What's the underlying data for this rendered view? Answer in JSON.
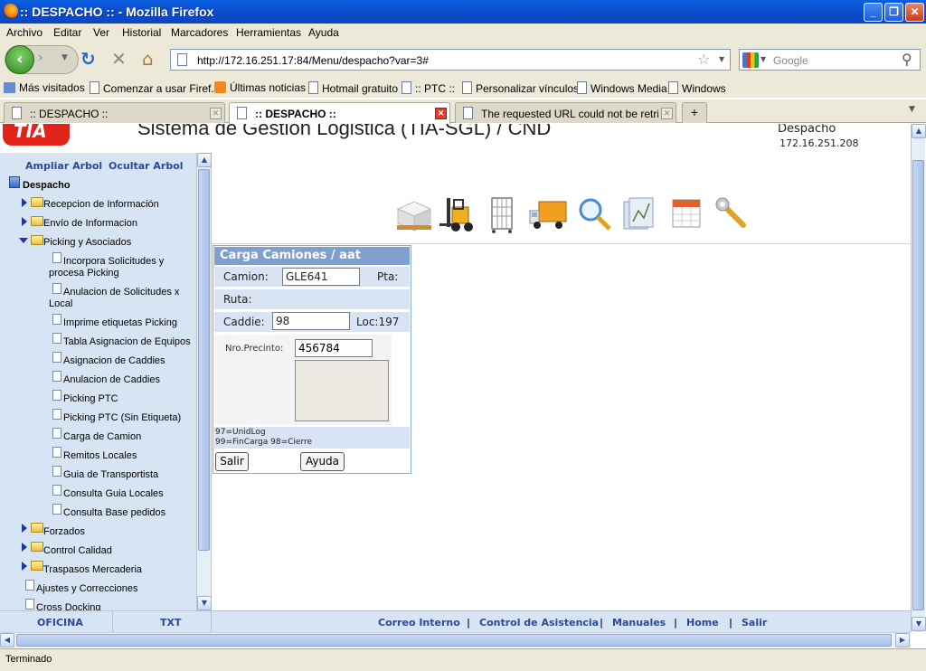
{
  "window": {
    "title": ":: DESPACHO :: - Mozilla Firefox"
  },
  "menu": [
    "Archivo",
    "Editar",
    "Ver",
    "Historial",
    "Marcadores",
    "Herramientas",
    "Ayuda"
  ],
  "nav": {
    "url": "http://172.16.251.17:84/Menu/despacho?var=3#",
    "search_placeholder": "Google"
  },
  "bookmarks": [
    "Más visitados",
    "Comenzar a usar Firef...",
    "Últimas noticias",
    "Hotmail gratuito",
    ":: PTC ::",
    "Personalizar vínculos",
    "Windows Media",
    "Windows"
  ],
  "tabs": [
    ":: DESPACHO ::",
    ":: DESPACHO ::",
    "The requested URL could not be retriev..."
  ],
  "header": {
    "logo_text": "TIA",
    "system_title": "Sistema de Gestion Logistica (TIA-SGL) / CND",
    "module": "Despacho",
    "host": "172.16.251.208"
  },
  "tree": {
    "expand_label": "Ampliar Arbol",
    "hide_label": "Ocultar Arbol",
    "root": "Despacho",
    "items": [
      {
        "label": "Recepcion de Información"
      },
      {
        "label": "Envío de Informacion"
      },
      {
        "label": "Picking y Asociados"
      },
      {
        "label": "Incorpora Solicitudes y"
      },
      {
        "label": "procesa Picking"
      },
      {
        "label": "Anulacion de Solicitudes x"
      },
      {
        "label": "Local"
      },
      {
        "label": "Imprime etiquetas Picking"
      },
      {
        "label": "Tabla Asignacion de Equipos"
      },
      {
        "label": "Asignacion de Caddies"
      },
      {
        "label": "Anulacion de Caddies"
      },
      {
        "label": "Picking PTC"
      },
      {
        "label": "Picking PTC (Sin Etiqueta)"
      },
      {
        "label": "Carga de Camion"
      },
      {
        "label": "Remitos Locales"
      },
      {
        "label": "Guia de Transportista"
      },
      {
        "label": "Consulta Guia Locales"
      },
      {
        "label": "Consulta Base pedidos"
      },
      {
        "label": "Forzados"
      },
      {
        "label": "Control Calidad"
      },
      {
        "label": "Traspasos Mercaderia"
      },
      {
        "label": "Ajustes y Correcciones"
      },
      {
        "label": "Cross Docking"
      }
    ]
  },
  "footer": {
    "left": [
      "OFICINA",
      "TXT"
    ],
    "links": [
      "Correo Interno",
      "Control de Asistencia",
      "Manuales",
      "Home",
      "Salir"
    ],
    "sep": "|"
  },
  "form": {
    "title": "Carga Camiones / aat",
    "camion_label": "Camion:",
    "camion_value": "GLE641",
    "pta_label": "Pta:",
    "ruta_label": "Ruta:",
    "caddie_label": "Caddie:",
    "caddie_value": "98",
    "loc_label": "Loc:197",
    "precinto_label": "Nro.Precinto:",
    "precinto_value": "456784",
    "hint_line1": "97=UnidLog",
    "hint_line2": "99=FinCarga 98=Cierre",
    "salir_label": "Salir",
    "ayuda_label": "Ayuda"
  },
  "status": "Terminado"
}
